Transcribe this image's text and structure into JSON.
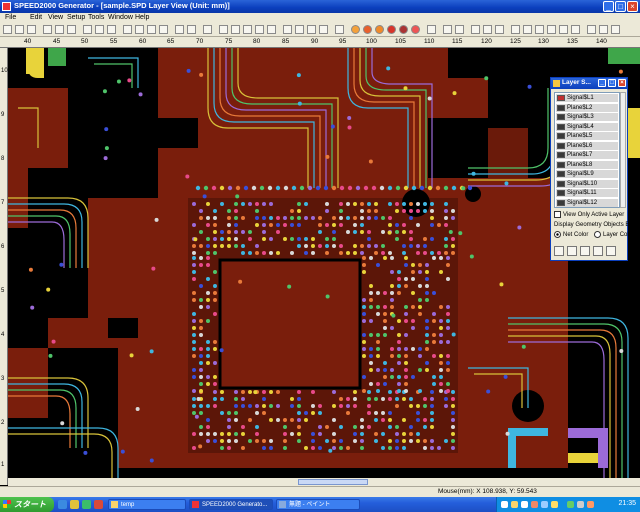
{
  "window": {
    "title": "SPEED2000 Generator - [sample.SPD Layer View (Unit: mm)]",
    "controls": {
      "minimize": "_",
      "maximize": "□",
      "close": "×"
    }
  },
  "menu": [
    "File",
    "Edit",
    "View",
    "Setup",
    "Tools",
    "Window",
    "Help"
  ],
  "ruler": {
    "top_labels": [
      "40",
      "45",
      "50",
      "55",
      "60",
      "65",
      "70",
      "75",
      "80",
      "85",
      "90",
      "95",
      "100",
      "105",
      "110",
      "115",
      "120",
      "125",
      "130",
      "135",
      "140"
    ],
    "left_labels": [
      "10",
      "9",
      "8",
      "7",
      "6",
      "5",
      "4",
      "3",
      "2",
      "1"
    ]
  },
  "layer_panel": {
    "title": "Layer S...",
    "layers": [
      {
        "name": "Signal$L1",
        "color": "#c03030"
      },
      {
        "name": "Plane$L2",
        "color": "#3a3a3a"
      },
      {
        "name": "Signal$L3",
        "color": "#3a3a3a"
      },
      {
        "name": "Signal$L4",
        "color": "#3a3a3a"
      },
      {
        "name": "Plane$L5",
        "color": "#3a3a3a"
      },
      {
        "name": "Plane$L6",
        "color": "#3a3a3a"
      },
      {
        "name": "Plane$L7",
        "color": "#3a3a3a"
      },
      {
        "name": "Plane$L8",
        "color": "#3a3a3a"
      },
      {
        "name": "Signal$L9",
        "color": "#3a3a3a"
      },
      {
        "name": "Signal$L10",
        "color": "#3a3a3a"
      },
      {
        "name": "Signal$L11",
        "color": "#3a3a3a"
      },
      {
        "name": "Signal$L12",
        "color": "#3a3a3a"
      }
    ],
    "view_only_active": "View Only Active Layer",
    "display_label": "Display Geometry Objects By",
    "option_net": "Net Color",
    "option_layer": "Layer Color"
  },
  "status": {
    "mouse": "Mouse(mm): X 108.938, Y: 59.543"
  },
  "taskbar": {
    "start": "スタート",
    "tasks": [
      "temp",
      "SPEED2000 Generato...",
      "無題 - ペイント"
    ],
    "clock": "21:35"
  },
  "colors": {
    "board": "#7a1e0c",
    "board_dark": "#5c1608",
    "background": "#000000"
  }
}
